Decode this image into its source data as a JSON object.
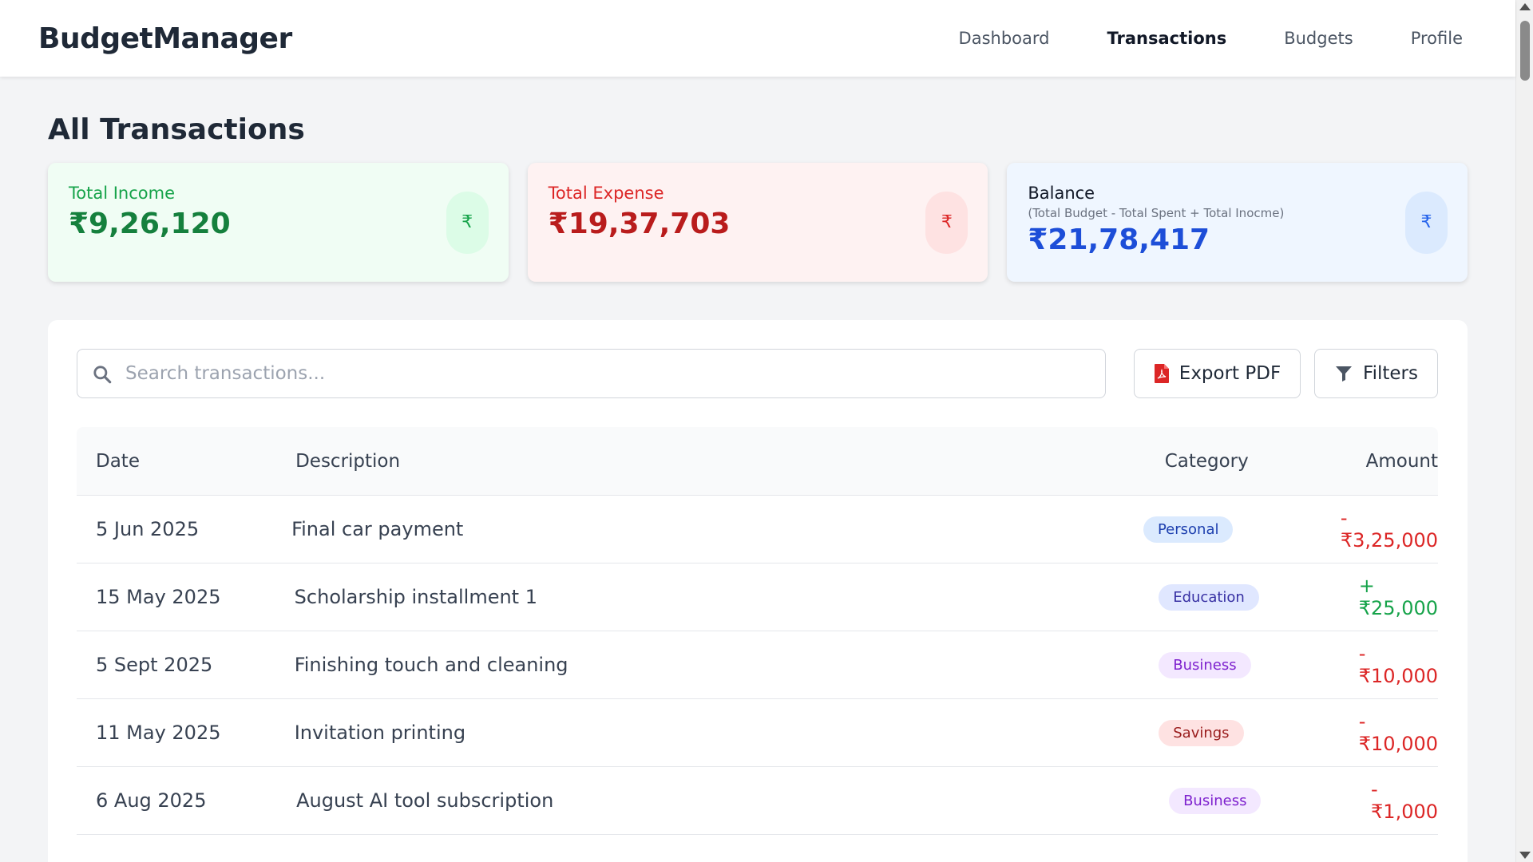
{
  "app": {
    "brand": "BudgetManager",
    "nav": [
      {
        "label": "Dashboard",
        "active": false
      },
      {
        "label": "Transactions",
        "active": true
      },
      {
        "label": "Budgets",
        "active": false
      },
      {
        "label": "Profile",
        "active": false
      }
    ]
  },
  "page": {
    "title": "All Transactions"
  },
  "summary": {
    "income": {
      "label": "Total Income",
      "value": "₹9,26,120",
      "icon": "rupee-icon"
    },
    "expense": {
      "label": "Total Expense",
      "value": "₹19,37,703",
      "icon": "rupee-icon"
    },
    "balance": {
      "label": "Balance",
      "sub": "(Total Budget - Total Spent + Total Inocme)",
      "value": "₹21,78,417",
      "icon": "rupee-icon"
    }
  },
  "toolbar": {
    "search_placeholder": "Search transactions...",
    "export_label": "Export PDF",
    "filters_label": "Filters"
  },
  "table": {
    "headers": {
      "date": "Date",
      "description": "Description",
      "category": "Category",
      "amount": "Amount"
    },
    "rows": [
      {
        "date": "5 Jun 2025",
        "description": "Final car payment",
        "category": "Personal",
        "category_style": "personal",
        "amount": "-₹3,25,000",
        "sign": "neg"
      },
      {
        "date": "15 May 2025",
        "description": "Scholarship installment 1",
        "category": "Education",
        "category_style": "education",
        "amount": "+₹25,000",
        "sign": "pos"
      },
      {
        "date": "5 Sept 2025",
        "description": "Finishing touch and cleaning",
        "category": "Business",
        "category_style": "business",
        "amount": "-₹10,000",
        "sign": "neg"
      },
      {
        "date": "11 May 2025",
        "description": "Invitation printing",
        "category": "Savings",
        "category_style": "savings",
        "amount": "-₹10,000",
        "sign": "neg"
      },
      {
        "date": "6 Aug 2025",
        "description": "August AI tool subscription",
        "category": "Business",
        "category_style": "business",
        "amount": "-₹1,000",
        "sign": "neg"
      }
    ]
  },
  "colors": {
    "income": "#16a34a",
    "expense": "#dc2626",
    "balance": "#1d4ed8",
    "pdf_red": "#dc2626"
  }
}
